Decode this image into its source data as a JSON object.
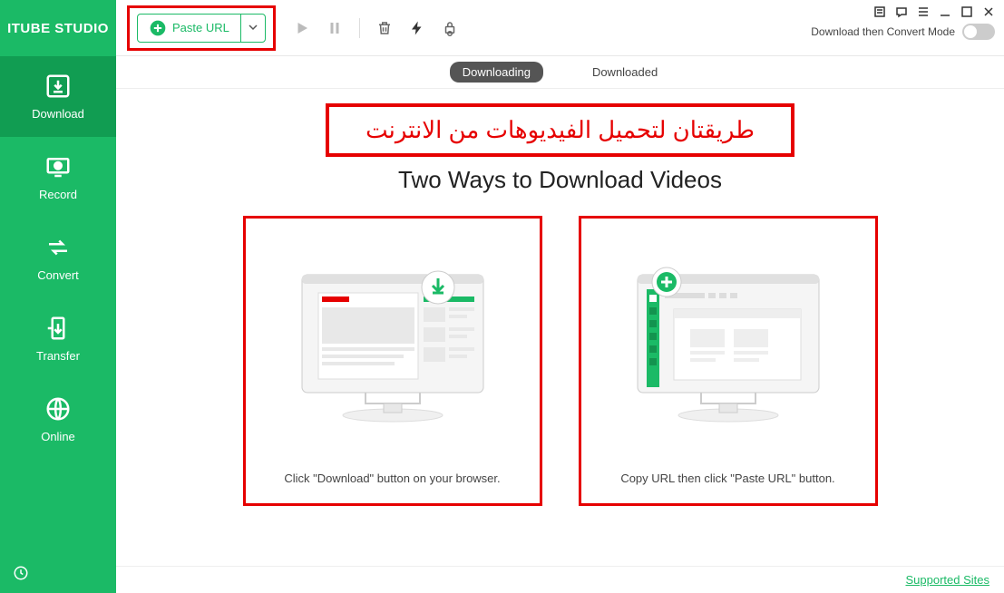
{
  "app": {
    "title": "ITUBE STUDIO"
  },
  "sidebar": {
    "items": [
      {
        "label": "Download"
      },
      {
        "label": "Record"
      },
      {
        "label": "Convert"
      },
      {
        "label": "Transfer"
      },
      {
        "label": "Online"
      }
    ]
  },
  "toolbar": {
    "paste_label": "Paste URL",
    "mode_label": "Download then Convert Mode"
  },
  "tabs": {
    "downloading": "Downloading",
    "downloaded": "Downloaded"
  },
  "content": {
    "arabic_title": "طريقتان لتحميل الفيديوهات من الانترنت",
    "subtitle": "Two Ways to Download Videos",
    "card1_text": "Click \"Download\" button on your browser.",
    "card2_text": "Copy URL then click \"Paste URL\" button."
  },
  "footer": {
    "link": "Supported Sites"
  }
}
